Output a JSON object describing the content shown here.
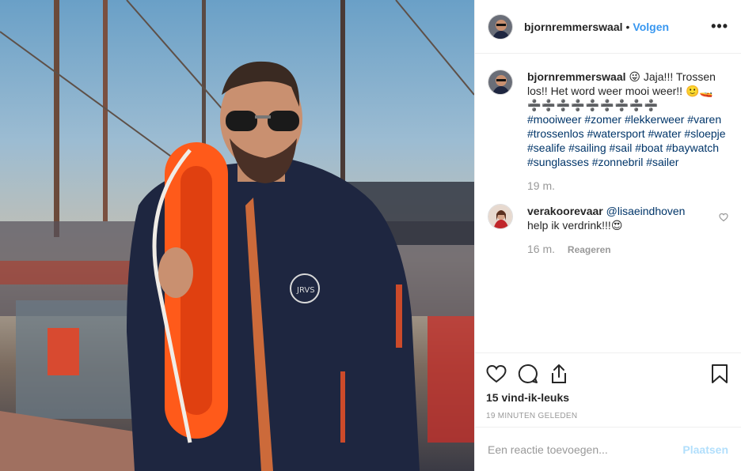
{
  "header": {
    "username": "bjornremmerswaal",
    "separator": "•",
    "follow_label": "Volgen",
    "more_label": "•••"
  },
  "caption": {
    "username": "bjornremmerswaal",
    "text_line1": "😜 Jaja!!! Trossen los!! Het word weer mooi weer!! 🙂🚤",
    "divider": "➗➗➗➗➗➗➗➗➗",
    "hashtags": "#mooiweer #zomer #lekkerweer #varen #trossenlos #watersport #water #sloepje #sealife #sailing #sail #boat #baywatch #sunglasses #zonnebril #sailer",
    "time": "19 m."
  },
  "comment": {
    "username": "verakoorevaar",
    "mention": "@lisaeindhoven",
    "text": "help ik verdrink!!!😍",
    "time": "16 m.",
    "reply_label": "Reageren"
  },
  "actions": {
    "likes": "15 vind-ik-leuks",
    "timestamp": "19 MINUTEN GELEDEN"
  },
  "add_comment": {
    "placeholder": "Een reactie toevoegen...",
    "post_label": "Plaatsen"
  },
  "colors": {
    "link_blue": "#3897f0",
    "hashtag": "#003569",
    "muted": "#999999",
    "post_disabled": "#b2dffc"
  },
  "icons": [
    "more-icon",
    "heart-icon",
    "comment-icon",
    "share-icon",
    "save-icon",
    "heart-small-icon"
  ]
}
